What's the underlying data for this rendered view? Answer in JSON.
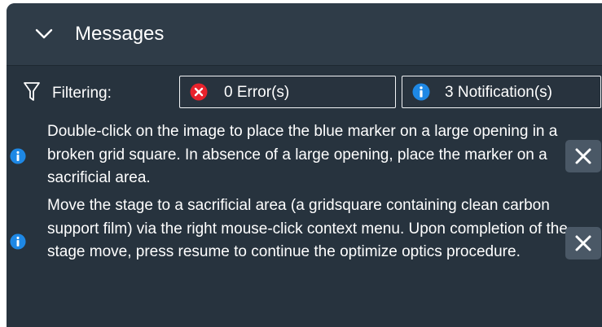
{
  "header": {
    "title": "Messages",
    "collapse_icon": "chevron-down-icon"
  },
  "filter": {
    "label": "Filtering:",
    "icon": "funnel-icon",
    "errors_label": "0 Error(s)",
    "errors_icon": "error-icon",
    "errors_color": "#e8222c",
    "notifications_label": "3 Notification(s)",
    "notifications_icon": "info-icon",
    "notifications_color": "#1e88e5"
  },
  "messages": [
    {
      "icon": "info-icon",
      "text": "Double-click on the image to place the blue marker on a large opening in a broken grid square. In absence of a large opening, place the marker on a sacrificial area.",
      "dismiss_icon": "close-icon"
    },
    {
      "icon": "info-icon",
      "text": "Move the stage to a sacrificial area (a gridsquare containing clean carbon support film) via the right mouse-click context menu. Upon completion of the stage move, press resume to continue the optimize optics procedure.",
      "dismiss_icon": "close-icon"
    }
  ],
  "colors": {
    "panel_background": "#27333e",
    "header_background": "#2f3c48",
    "dismiss_button": "#4a5866",
    "text": "#ffffff"
  }
}
